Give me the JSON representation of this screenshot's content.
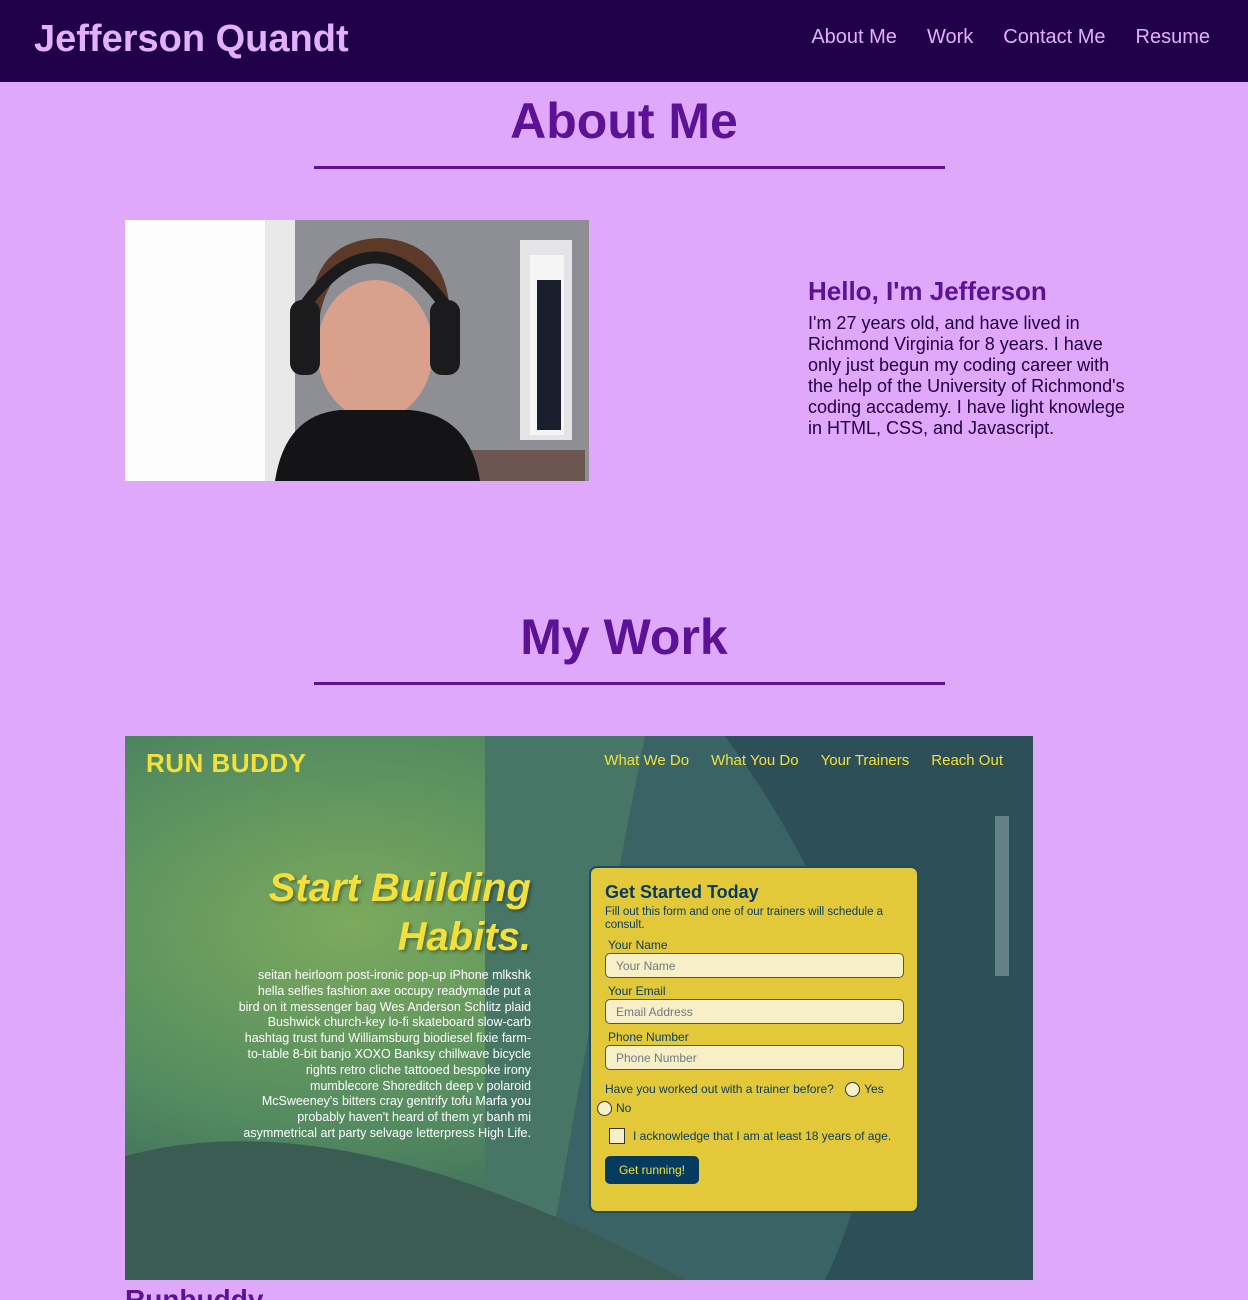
{
  "header": {
    "title": "Jefferson Quandt",
    "nav": [
      "About Me",
      "Work",
      "Contact Me",
      "Resume"
    ]
  },
  "about": {
    "heading": "About Me",
    "bio_title": "Hello, I'm Jefferson",
    "bio_text": "I'm 27 years old, and have lived in Richmond Virginia for 8 years. I have only just begun my coding career with the help of the University of Richmond's coding accademy. I have light knowlege in HTML, CSS, and Javascript."
  },
  "work": {
    "heading": "My Work",
    "caption": "Runbuddy",
    "project": {
      "logo": "RUN BUDDY",
      "nav": [
        "What We Do",
        "What You Do",
        "Your Trainers",
        "Reach Out"
      ],
      "hero_title_1": "Start Building",
      "hero_title_2": "Habits.",
      "hero_text": "seitan heirloom post-ironic pop-up iPhone mlkshk hella selfies fashion axe occupy readymade put a bird on it messenger bag Wes Anderson Schlitz plaid Bushwick church-key lo-fi skateboard slow-carb hashtag trust fund Williamsburg biodiesel fixie farm-to-table 8-bit banjo XOXO Banksy chillwave bicycle rights retro cliche tattooed bespoke irony mumblecore Shoreditch deep v polaroid McSweeney's bitters cray gentrify tofu Marfa you probably haven't heard of them yr banh mi asymmetrical art party selvage letterpress High Life.",
      "form": {
        "title": "Get Started Today",
        "subtitle": "Fill out this form and one of our trainers will schedule a consult.",
        "name_label": "Your Name",
        "name_placeholder": "Your Name",
        "email_label": "Your Email",
        "email_placeholder": "Email Address",
        "phone_label": "Phone Number",
        "phone_placeholder": "Phone Number",
        "question": "Have you worked out with a trainer before?",
        "yes": "Yes",
        "no": "No",
        "ack": "I acknowledge that I am at least 18 years of age.",
        "button": "Get running!"
      }
    }
  },
  "colors": {
    "page_bg": "#dfa8fb",
    "header_bg": "#21004a",
    "accent": "#5b1294",
    "rb_yellow": "#f3e03a",
    "rb_navy": "#053b5e"
  }
}
